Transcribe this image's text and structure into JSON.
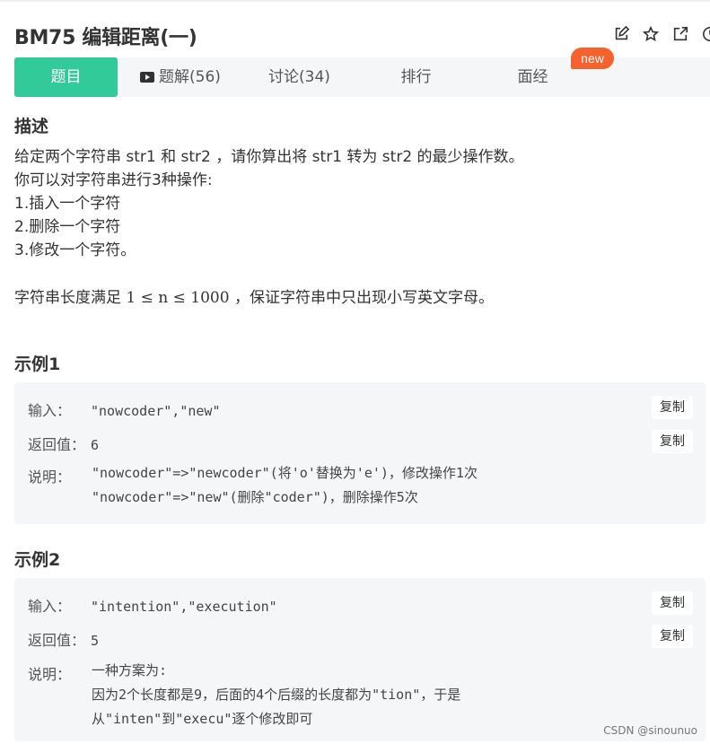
{
  "header": {
    "title": "BM75  编辑距离(一)",
    "icons": [
      "edit-icon",
      "star-icon",
      "share-external-icon",
      "clock-icon"
    ]
  },
  "tabs": [
    {
      "label": "题目",
      "active": true
    },
    {
      "label": "题解(56)",
      "icon": "video-icon"
    },
    {
      "label": "讨论(34)"
    },
    {
      "label": "排行"
    },
    {
      "label": "面经"
    }
  ],
  "badge": {
    "new": "new"
  },
  "description": {
    "heading": "描述",
    "lines": [
      "给定两个字符串 str1 和 str2 ，请你算出将 str1 转为 str2 的最少操作数。",
      "你可以对字符串进行3种操作:",
      "1.插入一个字符",
      "2.删除一个字符",
      "3.修改一个字符。"
    ],
    "constraint_prefix": "字符串长度满足 ",
    "constraint_math": "1 ≤ n ≤ 1000",
    "constraint_suffix": " ，保证字符串中只出现小写英文字母。"
  },
  "examples": [
    {
      "heading": "示例1",
      "input_label": "输入：",
      "input_value": "\"nowcoder\",\"new\"",
      "return_label": "返回值：",
      "return_value": "6",
      "explain_label": "说明：",
      "explain_lines": [
        "\"nowcoder\"=>\"newcoder\"(将'o'替换为'e')，修改操作1次",
        "\"nowcoder\"=>\"new\"(删除\"coder\")，删除操作5次"
      ],
      "copy_label": "复制"
    },
    {
      "heading": "示例2",
      "input_label": "输入：",
      "input_value": "\"intention\",\"execution\"",
      "return_label": "返回值：",
      "return_value": "5",
      "explain_label": "说明：",
      "explain_lines": [
        "一种方案为:",
        "因为2个长度都是9，后面的4个后缀的长度都为\"tion\"，于是",
        "从\"inten\"到\"execu\"逐个修改即可"
      ],
      "copy_label": "复制"
    }
  ],
  "watermark": "CSDN @sinounuo"
}
